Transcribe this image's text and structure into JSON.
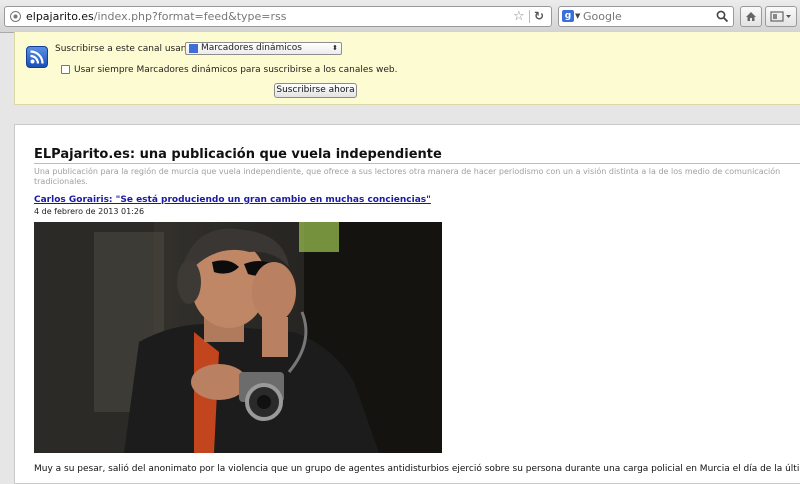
{
  "browser": {
    "url_host": "elpajarito.es",
    "url_path": "/index.php?format=feed&type=rss",
    "search_placeholder": "Google"
  },
  "subscribe": {
    "label": "Suscribirse a este canal usando",
    "reader_selected": "Marcadores dinámicos",
    "always_label": "Usar siempre Marcadores dinámicos para suscribirse a los canales web.",
    "always_checked": false,
    "button_label": "Suscribirse ahora"
  },
  "feed": {
    "title": "ELPajarito.es: una publicación que vuela independiente",
    "description": "Una publicación para la región de murcia que vuela independiente, que ofrece a sus lectores otra manera de hacer periodismo con un a visión distinta a la de los medio de comunicación tradicionales.",
    "entry": {
      "title": "Carlos Gorairis: \"Se está produciendo un gran cambio en muchas conciencias\"",
      "date": "4 de febrero de 2013 01:26",
      "body": "Muy a su pesar, salió del anonimato por la violencia que un grupo de agentes antidisturbios ejerció sobre su persona durante una carga policial en Murcia el día de la última huelga general."
    }
  },
  "colors": {
    "link": "#1a1aa6",
    "subscribe_bg": "#fdfbd1"
  }
}
